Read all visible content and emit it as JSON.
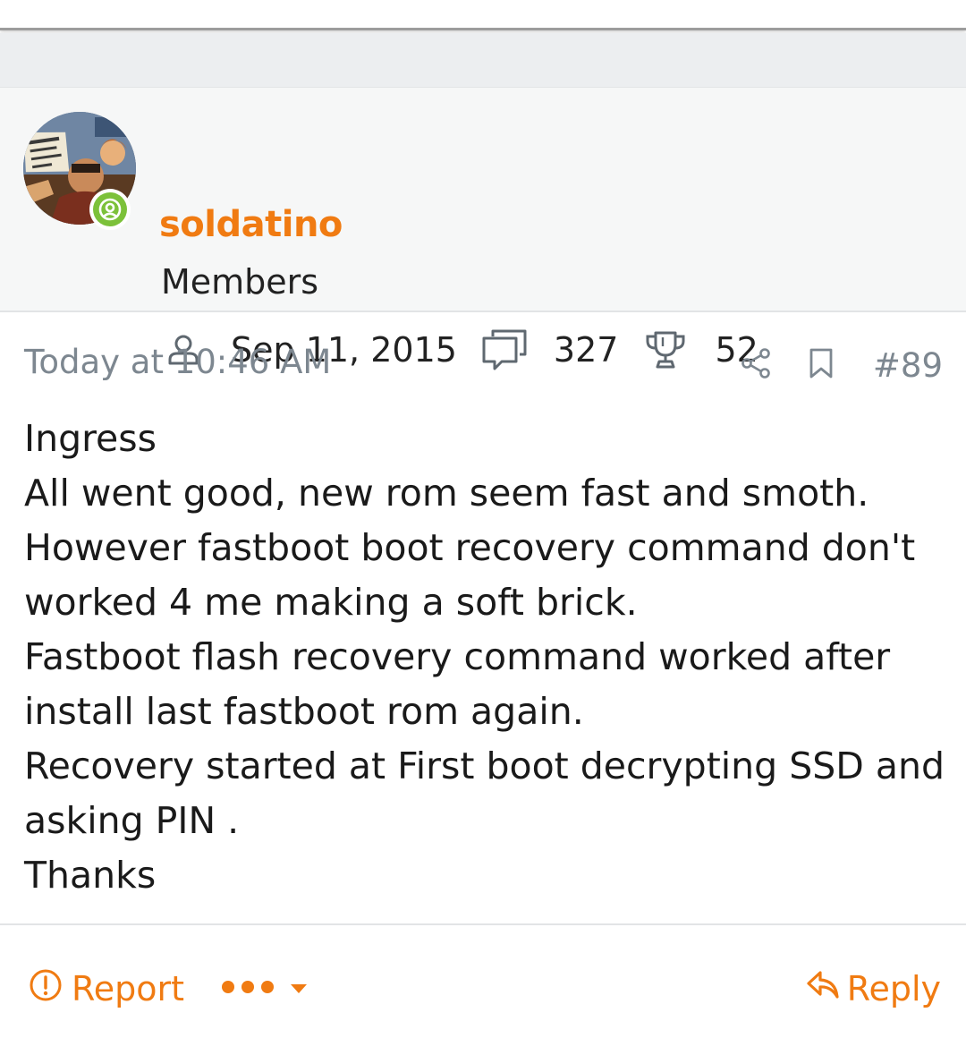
{
  "author": {
    "username": "soldatino",
    "title": "Members",
    "joined": "Sep 11, 2015",
    "messages": "327",
    "reactions": "52",
    "online": true
  },
  "post": {
    "date": "Today at 10:46 AM",
    "number": "#89",
    "lines": [
      "Ingress",
      "All went good, new rom seem fast and smoth.",
      "However fastboot boot recovery command don't",
      "worked 4 me making a soft brick.",
      "Fastboot flash recovery command worked after",
      "install last fastboot rom again.",
      "Recovery started at First boot decrypting SSD and",
      "asking PIN .",
      "Thanks"
    ]
  },
  "footer": {
    "report_label": "Report",
    "reply_label": "Reply"
  },
  "colors": {
    "accent": "#f07b12",
    "muted": "#7d8790",
    "online": "#7cc13a",
    "panel": "#f6f7f7"
  },
  "icons": {
    "online": "user-circle-icon",
    "joined": "user-icon",
    "messages": "comments-icon",
    "reactions": "trophy-icon",
    "share": "share-icon",
    "bookmark": "bookmark-icon",
    "report": "warning-circle-icon",
    "more": "more-dots-icon",
    "dropdown": "caret-down-icon",
    "reply": "reply-arrow-icon"
  }
}
